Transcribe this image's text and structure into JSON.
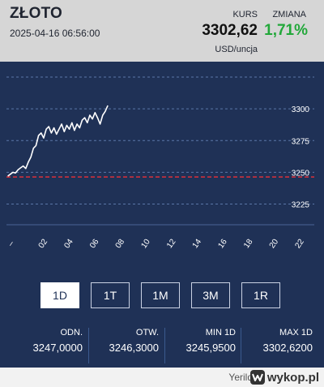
{
  "header": {
    "title": "ZŁOTO",
    "datetime": "2025-04-16 06:56:00",
    "kurs_label": "KURS",
    "kurs_value": "3302,62",
    "zmiana_label": "ZMIANA",
    "zmiana_value": "1,71%",
    "unit": "USD/uncja"
  },
  "colors": {
    "header_bg": "#d6d6d6",
    "panel_bg": "#1f3156",
    "positive": "#22a83a",
    "reference_line": "#d9313b",
    "series_line": "#ffffff"
  },
  "chart_data": {
    "type": "line",
    "y_ticks": [
      "3300",
      "3275",
      "3250",
      "3225"
    ],
    "x_ticks": [
      "–",
      "02",
      "04",
      "06",
      "08",
      "10",
      "12",
      "14",
      "16",
      "18",
      "20",
      "22"
    ],
    "ylim": [
      3210,
      3325
    ],
    "xlim": [
      -1,
      23
    ],
    "grid": true,
    "reference_value": 3246.3,
    "series": [
      {
        "x": [
          -0.9,
          -0.7,
          -0.5,
          -0.3,
          -0.1,
          0.1,
          0.3,
          0.5,
          0.7,
          0.9,
          1.1,
          1.3,
          1.5,
          1.7,
          1.9,
          2.1,
          2.3,
          2.5,
          2.7,
          2.9,
          3.1,
          3.3,
          3.5,
          3.7,
          3.9,
          4.1,
          4.3,
          4.5,
          4.7,
          4.9,
          5.1,
          5.3,
          5.5,
          5.7,
          5.9,
          6.1,
          6.3,
          6.5,
          6.7,
          6.9
        ],
        "values": [
          3247.0,
          3248.5,
          3250.0,
          3249.5,
          3252.0,
          3253.5,
          3255.0,
          3253.0,
          3258.0,
          3262.0,
          3269.0,
          3271.0,
          3279.0,
          3281.0,
          3277.0,
          3284.0,
          3286.0,
          3281.0,
          3285.0,
          3280.0,
          3284.0,
          3288.0,
          3282.0,
          3287.0,
          3284.0,
          3289.0,
          3283.0,
          3288.0,
          3285.0,
          3291.0,
          3293.0,
          3289.0,
          3295.0,
          3292.0,
          3297.0,
          3293.0,
          3288.0,
          3295.0,
          3298.0,
          3302.6
        ]
      }
    ]
  },
  "ranges": {
    "active": "1D",
    "items": [
      "1D",
      "1T",
      "1M",
      "3M",
      "1R"
    ]
  },
  "stats": [
    {
      "label": "ODN.",
      "value": "3247,0000"
    },
    {
      "label": "OTW.",
      "value": "3246,3000"
    },
    {
      "label": "MIN 1D",
      "value": "3245,9500"
    },
    {
      "label": "MAX 1D",
      "value": "3302,6200"
    }
  ],
  "footer": {
    "credit": "Yerild",
    "brand_icon": "wykop-logo-icon",
    "brand_text": "wykop.pl"
  }
}
